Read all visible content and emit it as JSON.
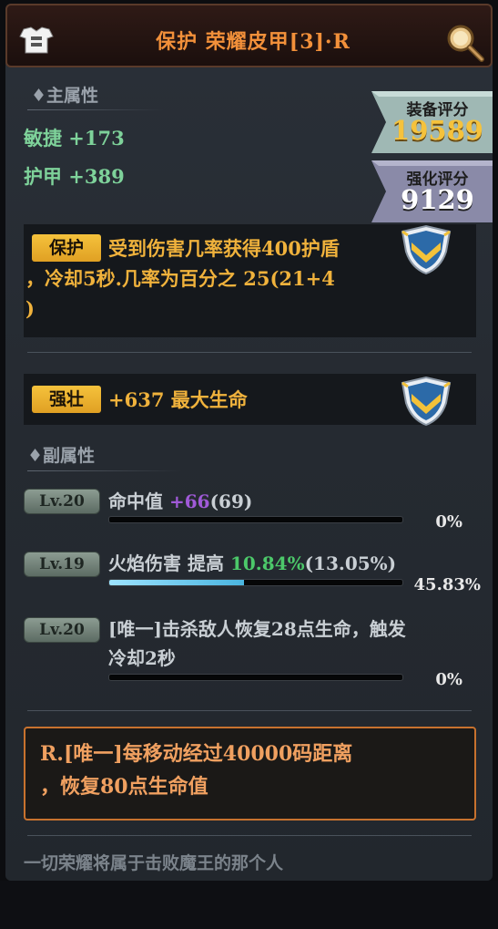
{
  "header": {
    "title": "保护 荣耀皮甲[3]·R",
    "armor_icon": "armor-icon",
    "search_icon": "magnifier-icon"
  },
  "main_attr": {
    "title": "♦主属性",
    "items": [
      "敏捷 +173",
      "护甲 +389"
    ]
  },
  "scores": {
    "equip_label": "装备评分",
    "equip_value": "19589",
    "enhance_label": "强化评分",
    "enhance_value": "9129"
  },
  "effects": [
    {
      "tag": "保护",
      "lines": [
        "受到伤害几率获得400护盾",
        "，冷却5秒.几率为百分之 25(21+4",
        ")"
      ],
      "icon": "shield-badge-icon"
    },
    {
      "tag": "强壮",
      "lines": [
        "+637 最大生命"
      ],
      "icon": "shield-badge-icon"
    }
  ],
  "sub_attr": {
    "title": "♦副属性",
    "items": [
      {
        "level": "Lv.20",
        "name": "命中值 ",
        "bonus": "+66",
        "base": "(69)",
        "progress": 0,
        "percent": "0%"
      },
      {
        "level": "Lv.19",
        "name": "火焰伤害 提高 ",
        "bonus": "10.84%",
        "base": "(13.05%)",
        "progress": 0.4583,
        "percent": "45.83%"
      },
      {
        "level": "Lv.20",
        "name": "[唯一]击杀敌人恢复28点生命，触发",
        "name2": "冷却2秒",
        "progress": 0,
        "percent": "0%"
      }
    ]
  },
  "unique": {
    "lines": [
      "R.[唯一]每移动经过40000码距离",
      "，恢复80点生命值"
    ]
  },
  "flavor": "一切荣耀将属于击败魔王的那个人",
  "colors": {
    "title_orange": "#f2903a",
    "attr_green": "#7ed29a",
    "effect_gold": "#f0b23c",
    "bonus_purple": "#a05ad8",
    "bonus_green": "#4cc86a",
    "equip_score_gold": "#f5c23c",
    "enhance_score_white": "#ffffff"
  }
}
